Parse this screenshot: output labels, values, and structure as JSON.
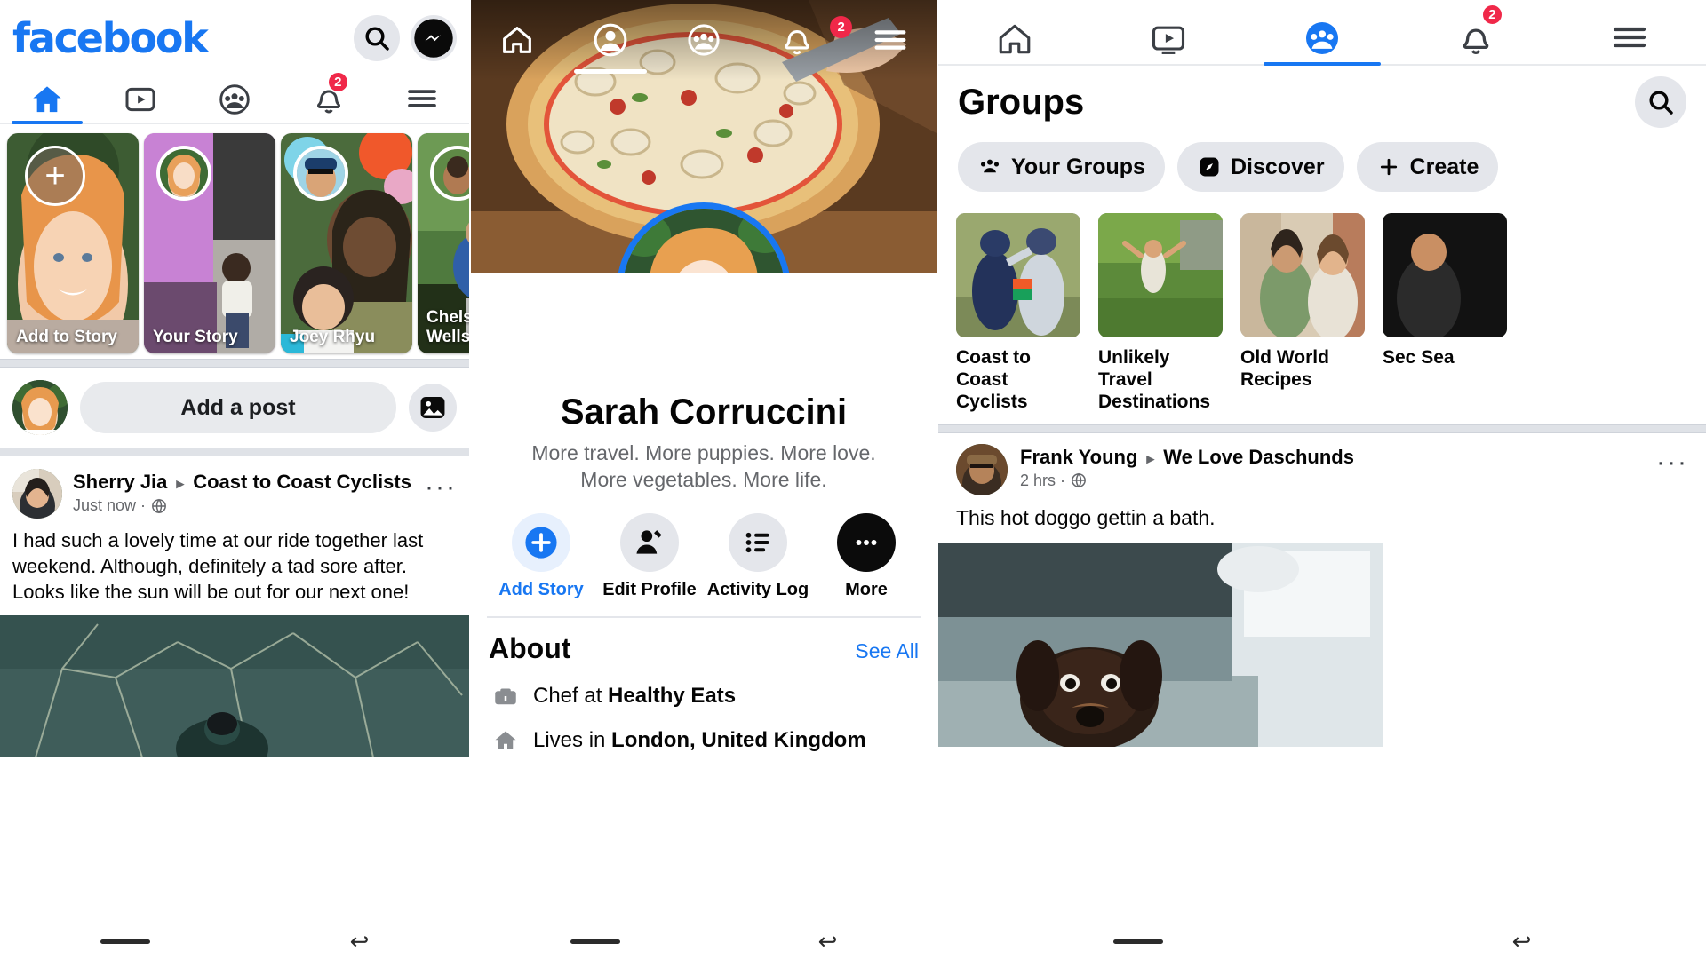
{
  "app": {
    "brand": "facebook",
    "brand_color": "#1877f2",
    "badge_color": "#f02849"
  },
  "feed": {
    "top_icons": [
      {
        "name": "search-icon",
        "label": "Search"
      },
      {
        "name": "messenger-icon",
        "label": "Messenger"
      }
    ],
    "tabs": [
      {
        "name": "home",
        "label": "Home",
        "icon": "home-icon",
        "active": true,
        "badge": ""
      },
      {
        "name": "watch",
        "label": "Watch",
        "icon": "video-icon",
        "active": false,
        "badge": ""
      },
      {
        "name": "groups",
        "label": "Groups",
        "icon": "groups-icon",
        "active": false,
        "badge": ""
      },
      {
        "name": "notifications",
        "label": "Notifications",
        "icon": "bell-icon",
        "active": false,
        "badge": "2"
      },
      {
        "name": "menu",
        "label": "Menu",
        "icon": "hamburger-icon",
        "active": false,
        "badge": ""
      }
    ],
    "stories": [
      {
        "label": "Add to Story",
        "type": "add"
      },
      {
        "label": "Your Story",
        "type": "story"
      },
      {
        "label": "Joey Rhyu",
        "type": "story"
      },
      {
        "label": "Chelsea Wells",
        "type": "story"
      }
    ],
    "composer": {
      "placeholder": "Add a post",
      "photo_icon": "photo-icon"
    },
    "post": {
      "author": "Sherry Jia",
      "group": "Coast to Coast Cyclists",
      "time": "Just now",
      "privacy_icon": "globe-icon",
      "menu_icon": "more-options-icon",
      "body": "I had such a lovely time at our ride together last weekend. Although, definitely a tad sore after. Looks like the sun will be out for our next one!"
    }
  },
  "profile": {
    "tabs": [
      {
        "name": "home",
        "icon": "home-icon",
        "active": false,
        "badge": ""
      },
      {
        "name": "profile",
        "icon": "profile-icon",
        "active": true,
        "badge": ""
      },
      {
        "name": "groups",
        "icon": "groups-icon",
        "active": false,
        "badge": ""
      },
      {
        "name": "notifications",
        "icon": "bell-icon",
        "active": false,
        "badge": "2"
      },
      {
        "name": "menu",
        "icon": "hamburger-icon",
        "active": false,
        "badge": ""
      }
    ],
    "name": "Sarah Corruccini",
    "bio_line_1": "More travel. More puppies. More love.",
    "bio_line_2": "More vegetables. More life.",
    "status": "online",
    "actions": [
      {
        "label": "Add Story",
        "icon": "plus-circle-icon",
        "accent": true
      },
      {
        "label": "Edit Profile",
        "icon": "edit-profile-icon",
        "accent": false
      },
      {
        "label": "Activity Log",
        "icon": "list-icon",
        "accent": false
      },
      {
        "label": "More",
        "icon": "more-options-icon",
        "accent": false
      }
    ],
    "about": {
      "title": "About",
      "see_all": "See All",
      "rows": [
        {
          "icon": "briefcase-icon",
          "prefix": "Chef at ",
          "bold": "Healthy Eats"
        },
        {
          "icon": "home-outline-icon",
          "prefix": "Lives in ",
          "bold": "London, United Kingdom"
        }
      ]
    }
  },
  "groups": {
    "tabs": [
      {
        "name": "home",
        "icon": "home-icon",
        "active": false,
        "badge": ""
      },
      {
        "name": "watch",
        "icon": "video-icon",
        "active": false,
        "badge": ""
      },
      {
        "name": "groups",
        "icon": "groups-icon",
        "active": true,
        "badge": ""
      },
      {
        "name": "notifications",
        "icon": "bell-icon",
        "active": false,
        "badge": "2"
      },
      {
        "name": "menu",
        "icon": "hamburger-icon",
        "active": false,
        "badge": ""
      }
    ],
    "title": "Groups",
    "search_icon": "search-icon",
    "chips": [
      {
        "label": "Your Groups",
        "icon": "groups-icon"
      },
      {
        "label": "Discover",
        "icon": "compass-icon"
      },
      {
        "label": "Create",
        "icon": "plus-icon"
      }
    ],
    "cards": [
      {
        "name": "Coast to Coast Cyclists"
      },
      {
        "name": "Unlikely Travel Destinations"
      },
      {
        "name": "Old World Recipes"
      },
      {
        "name": "Sec Sea"
      }
    ],
    "post": {
      "author": "Frank Young",
      "group": "We Love Daschunds",
      "time": "2 hrs",
      "privacy_icon": "globe-icon",
      "menu_icon": "more-options-icon",
      "body": "This hot doggo gettin a bath."
    }
  },
  "system_nav": {
    "pill": "home-gesture-pill",
    "back": "back-icon"
  }
}
